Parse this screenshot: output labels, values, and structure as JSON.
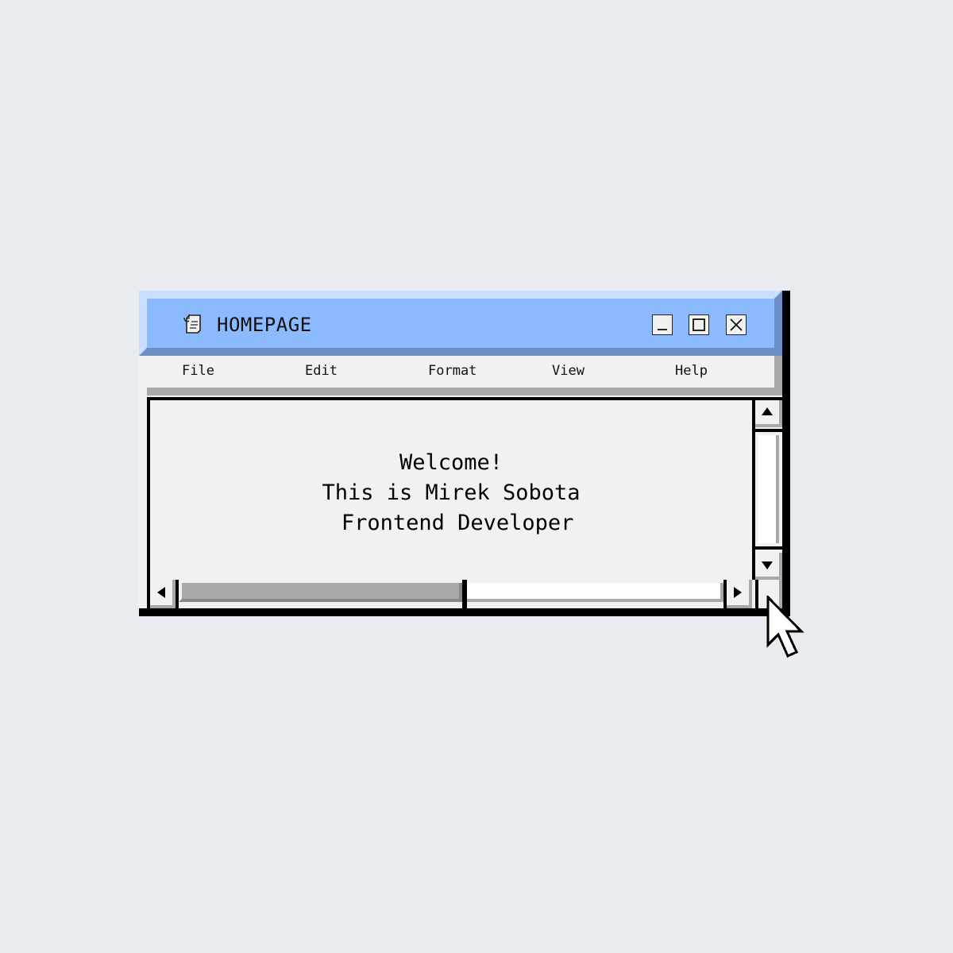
{
  "window": {
    "title": "HOMEPAGE",
    "title_icon": "notepad-icon",
    "controls": {
      "minimize": "minimize-icon",
      "maximize": "maximize-icon",
      "close": "close-icon"
    }
  },
  "menu": {
    "items": [
      "File",
      "Edit",
      "Format",
      "View",
      "Help"
    ]
  },
  "content": {
    "lines": [
      "Welcome!",
      "This is Mirek Sobota",
      " Frontend Developer"
    ]
  },
  "scrollbars": {
    "horizontal_position": 0.0,
    "vertical_position": 0.0,
    "horizontal_visible_fraction": 0.52
  },
  "colors": {
    "desktop": "#e8ebf0",
    "titlebar": "#8cbaff",
    "window": "#f1f1f1",
    "border": "#000000"
  }
}
